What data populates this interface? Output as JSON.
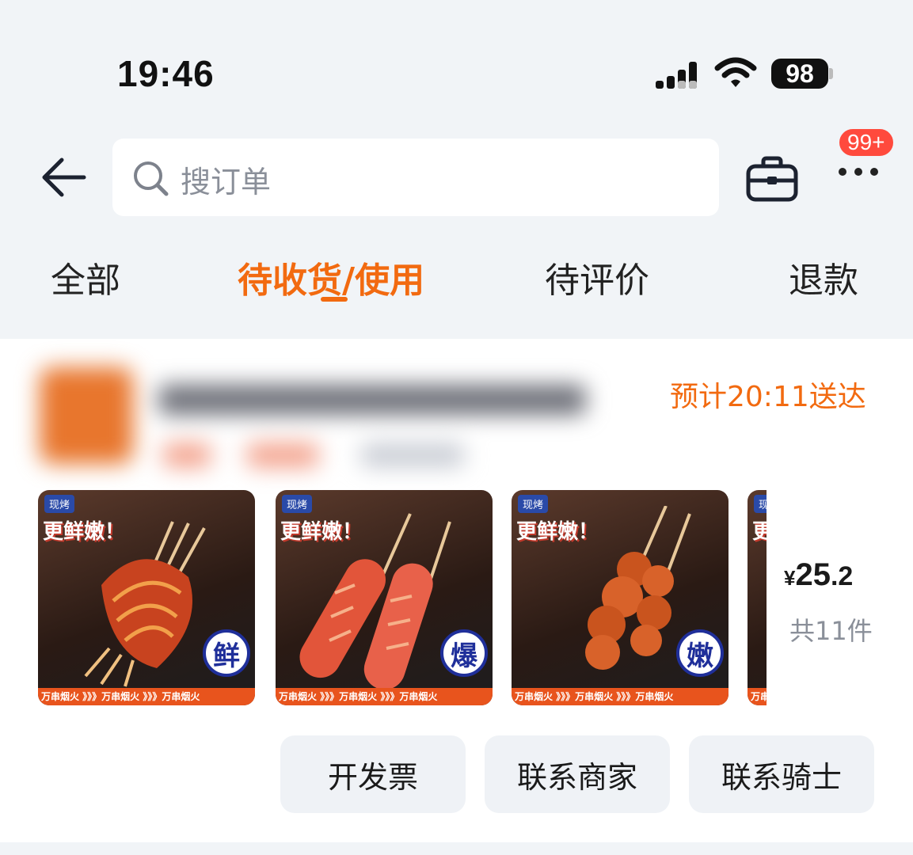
{
  "status_bar": {
    "time": "19:46",
    "battery": "98",
    "icons": [
      "signal-icon",
      "wifi-icon",
      "battery-icon"
    ]
  },
  "header": {
    "search_placeholder": "搜订单",
    "badge": "99+",
    "icons": [
      "back-arrow-icon",
      "search-icon",
      "briefcase-icon",
      "more-icon"
    ]
  },
  "tabs": [
    {
      "label": "全部",
      "active": false
    },
    {
      "label": "待收货/使用",
      "active": true
    },
    {
      "label": "待评价",
      "active": false
    },
    {
      "label": "退款",
      "active": false
    }
  ],
  "order": {
    "eta": "预计20:11送达",
    "products": [
      {
        "tag": "现烤",
        "headline": "更鲜嫩！",
        "stamp": "鲜",
        "band": "万串烟火 》》》万串烟火 》》》万串烟火"
      },
      {
        "tag": "现烤",
        "headline": "更鲜嫩！",
        "stamp": "爆",
        "band": "万串烟火 》》》万串烟火 》》》万串烟火"
      },
      {
        "tag": "现烤",
        "headline": "更鲜嫩！",
        "stamp": "嫩",
        "band": "万串烟火 》》》万串烟火 》》》万串烟火"
      },
      {
        "tag": "现烤",
        "headline": "更",
        "stamp": "",
        "band": "万串"
      }
    ],
    "price_currency": "¥",
    "price_int": "25",
    "price_dec": ".2",
    "count": "共11件",
    "actions": [
      "开发票",
      "联系商家",
      "联系骑士"
    ]
  },
  "colors": {
    "accent": "#f26a10",
    "badge": "#ff4a3d",
    "background": "#f1f4f7"
  }
}
